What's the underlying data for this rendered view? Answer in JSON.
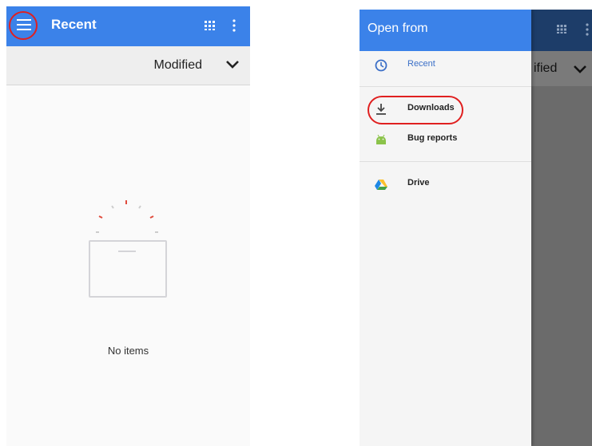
{
  "left": {
    "app_bar": {
      "title": "Recent"
    },
    "sort": {
      "label": "Modified"
    },
    "empty_state": {
      "text": "No items"
    }
  },
  "right": {
    "drawer": {
      "title": "Open from",
      "items": [
        {
          "label": "Recent",
          "icon": "clock-icon"
        },
        {
          "label": "Downloads",
          "icon": "download-icon"
        },
        {
          "label": "Bug reports",
          "icon": "android-icon"
        },
        {
          "label": "Drive",
          "icon": "drive-icon"
        }
      ]
    },
    "background": {
      "sort_label_partial": "ified"
    }
  },
  "colors": {
    "app_bar": "#3b82e9",
    "highlight_ring": "#e02020",
    "active_item": "#3b6fc7"
  }
}
